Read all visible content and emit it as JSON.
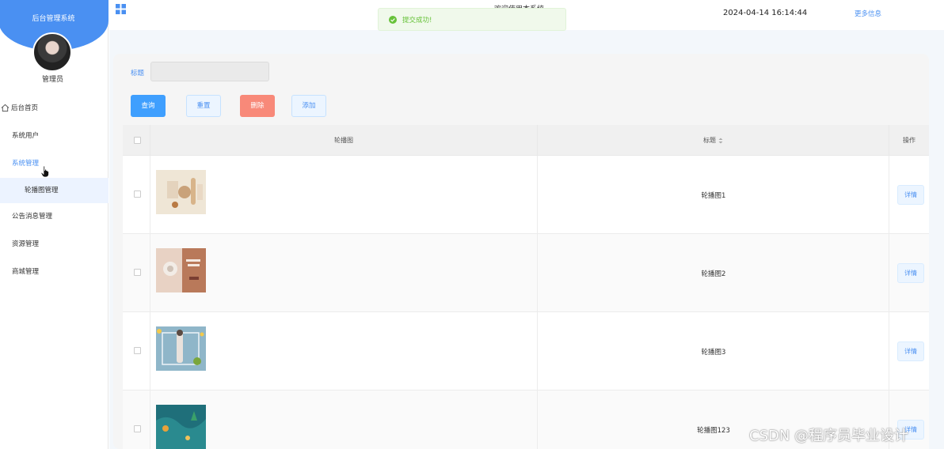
{
  "sidebar": {
    "brand_title": "后台管理系统",
    "user_role": "管理员",
    "items": [
      {
        "label": "后台首页",
        "icon": "home-icon"
      },
      {
        "label": "系统用户"
      },
      {
        "label": "系统管理"
      },
      {
        "label": "轮播图管理"
      },
      {
        "label": "公告消息管理"
      },
      {
        "label": "资源管理"
      },
      {
        "label": "商城管理"
      }
    ]
  },
  "topbar": {
    "fragment": "欢迎使用本系统",
    "datetime": "2024-04-14 16:14:44",
    "more_info": "更多信息"
  },
  "toast": {
    "message": "提交成功!",
    "type": "success",
    "color": "#67c23a"
  },
  "search": {
    "label": "标题",
    "value": ""
  },
  "buttons": {
    "query": "查询",
    "reset": "重置",
    "delete": "删除",
    "add": "添加"
  },
  "table": {
    "columns": [
      "轮播图",
      "标题",
      "操作"
    ],
    "rows": [
      {
        "title": "轮播图1",
        "action": "详情"
      },
      {
        "title": "轮播图2",
        "action": "详情"
      },
      {
        "title": "轮播图3",
        "action": "详情"
      },
      {
        "title": "轮播图123",
        "action": "详情"
      }
    ]
  },
  "watermark": "CSDN @程序员毕业设计",
  "colors": {
    "primary": "#4a90f2",
    "query_button": "#3f9ffe",
    "delete_button": "#f88979",
    "success": "#67c23a"
  }
}
